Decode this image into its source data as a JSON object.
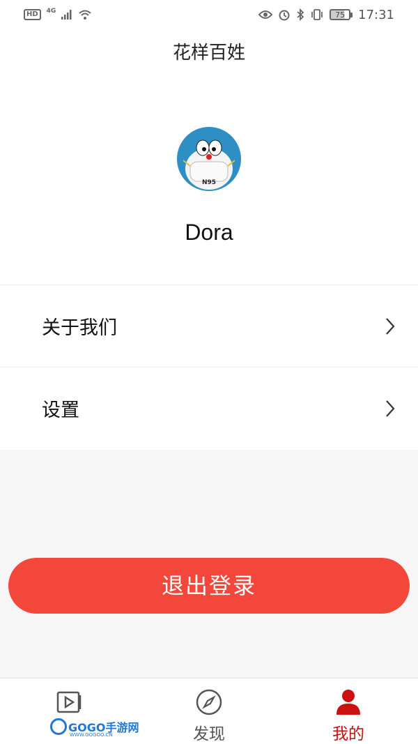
{
  "status_bar": {
    "left": {
      "hd": "HD",
      "network": "4G"
    },
    "right": {
      "battery": "75",
      "time": "17:31"
    },
    "icons": [
      "hd-icon",
      "signal-icon",
      "wifi-icon",
      "eye-icon",
      "alarm-icon",
      "bluetooth-icon",
      "vibrate-icon",
      "battery-icon"
    ]
  },
  "header": {
    "title": "花样百姓"
  },
  "profile": {
    "avatar_label": "N95",
    "username": "Dora"
  },
  "menu": {
    "items": [
      {
        "label": "关于我们",
        "icon": "chevron-right-icon"
      },
      {
        "label": "设置",
        "icon": "chevron-right-icon"
      }
    ]
  },
  "logout": {
    "label": "退出登录"
  },
  "tabbar": {
    "tabs": [
      {
        "label": "",
        "icon": "video-icon",
        "active": false
      },
      {
        "label": "发现",
        "icon": "compass-icon",
        "active": false
      },
      {
        "label": "我的",
        "icon": "person-icon",
        "active": true
      }
    ]
  },
  "watermark": {
    "text": "GOGO手游网",
    "url": "WWW.GOGOO.CN"
  },
  "colors": {
    "accent": "#f4473b",
    "active_tab": "#cc1010",
    "background_gray": "#f6f6f6"
  }
}
